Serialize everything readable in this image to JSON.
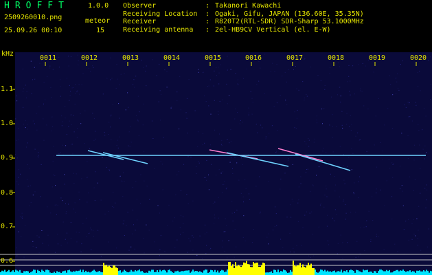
{
  "header": {
    "app_title": "HROFFT",
    "app_version": "1.0.0",
    "file_name": "2509260010.png",
    "datetime": "25.09.26 00:10",
    "meteor_label": "meteor",
    "meteor_count": "15"
  },
  "info": [
    {
      "key": "Observer",
      "sep": ":",
      "value": "Takanori Kawachi"
    },
    {
      "key": "Receiving Location",
      "sep": ":",
      "value": "Ogaki, Gifu, JAPAN (136.60E, 35.35N)"
    },
    {
      "key": "Receiver",
      "sep": ":",
      "value": "R820T2(RTL-SDR) SDR-Sharp 53.1000MHz"
    },
    {
      "key": "Receiving antenna",
      "sep": ":",
      "value": "2el-HB9CV Vertical (el. E-W)"
    }
  ],
  "spectrogram": {
    "unit_label": "kHz",
    "time_labels": [
      "0011",
      "0012",
      "0013",
      "0014",
      "0015",
      "0016",
      "0017",
      "0018",
      "0019",
      "0020"
    ],
    "freq_labels": [
      "1.1",
      "1.0",
      "0.9",
      "0.8",
      "0.7",
      "0.6"
    ],
    "colors": {
      "background": "#0a0a3a",
      "carrier": "#6fd3ff",
      "echo": "#ff7fd0",
      "level_cyan": "#00e5ff",
      "level_yellow": "#ffff00",
      "label_yellow": "#e6e600",
      "title_green": "#00ff66"
    }
  }
}
